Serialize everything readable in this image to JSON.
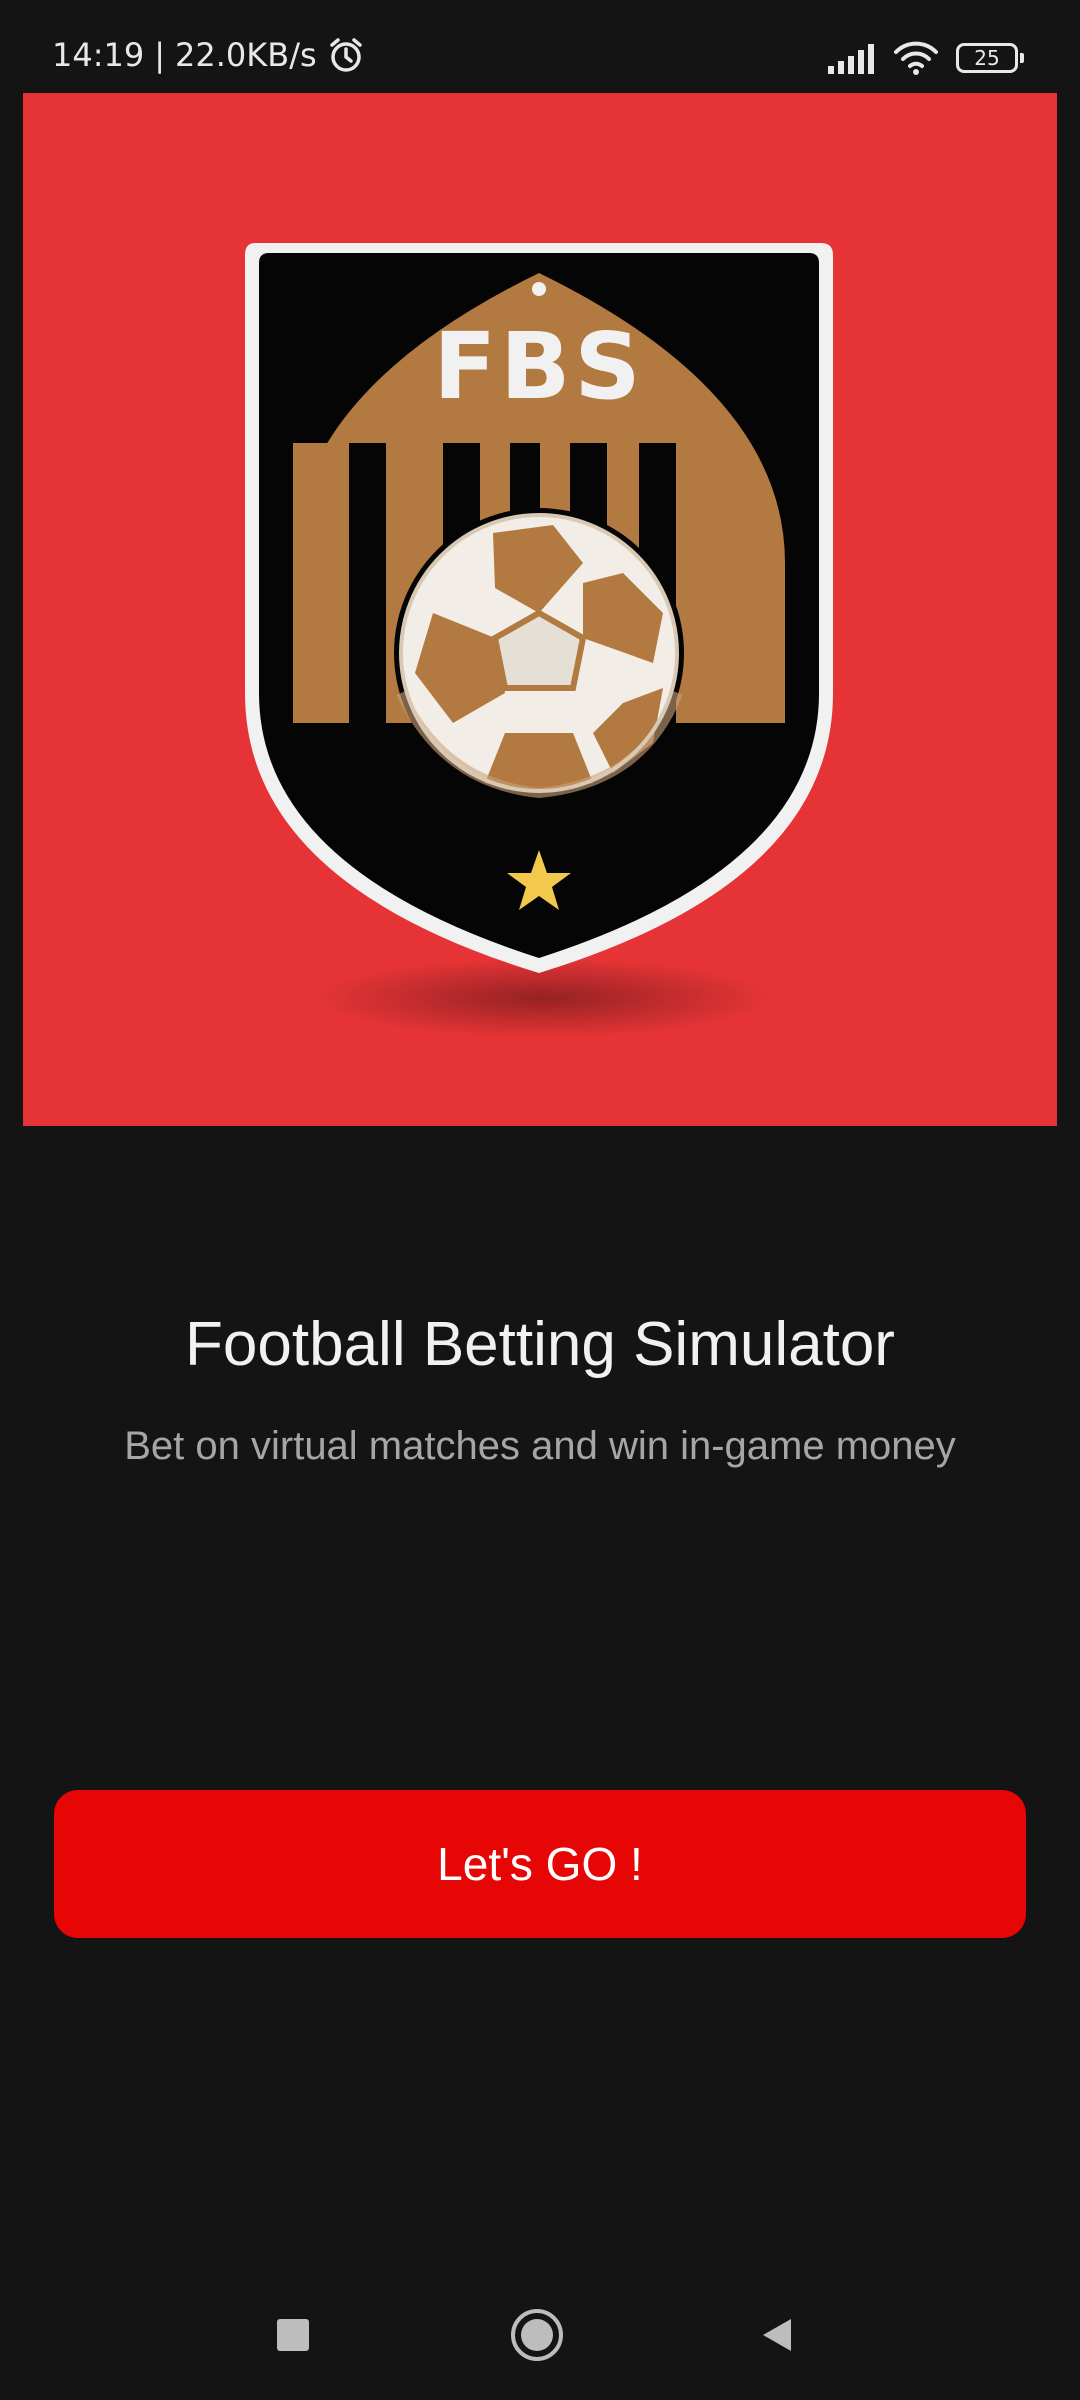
{
  "status_bar": {
    "time": "14:19",
    "separator": "|",
    "network_speed": "22.0KB/s",
    "battery_level": "25",
    "icons": [
      "alarm-icon",
      "signal-icon",
      "wifi-icon",
      "battery-icon"
    ]
  },
  "hero": {
    "logo_text": "FBS",
    "background_color": "#e63436",
    "shield_color": "#050505",
    "accent_color": "#b27a40",
    "star_color": "#f2c94c"
  },
  "main": {
    "title": "Football Betting Simulator",
    "subtitle": "Bet on virtual matches and win in-game money",
    "cta_label": "Let's GO !",
    "cta_color": "#e60606"
  },
  "nav_bar": {
    "icons": [
      "recents-square-icon",
      "home-circle-icon",
      "back-triangle-icon"
    ]
  }
}
